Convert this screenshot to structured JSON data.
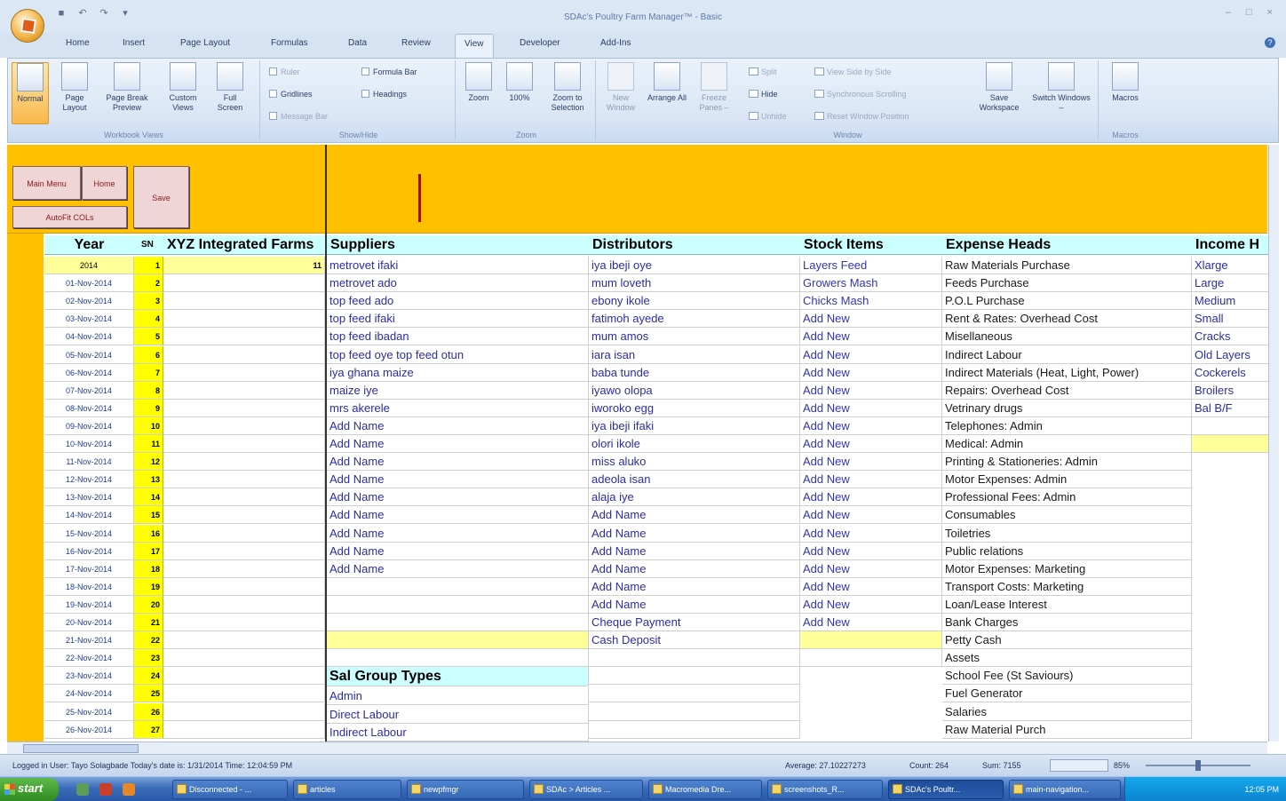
{
  "window": {
    "title": "SDAc's Poultry Farm Manager™ - Basic",
    "controls": "– □ ×"
  },
  "qat": {
    "save_icon": "■",
    "undo_icon": "↶",
    "redo_icon": "↷",
    "more_icon": "▾"
  },
  "ribbon_tabs": [
    "Home",
    "Insert",
    "Page Layout",
    "Formulas",
    "Data",
    "Review",
    "View",
    "Developer",
    "Add-Ins"
  ],
  "active_tab": "View",
  "ribbon": {
    "workbook_views": {
      "label": "Workbook Views",
      "buttons": [
        {
          "label": "Normal",
          "active": true
        },
        {
          "label": "Page Layout"
        },
        {
          "label": "Page Break Preview"
        },
        {
          "label": "Custom Views"
        },
        {
          "label": "Full Screen"
        }
      ]
    },
    "show_hide": {
      "label": "Show/Hide",
      "items": [
        "Ruler",
        "Formula Bar",
        "Gridlines",
        "Headings",
        "Message Bar"
      ]
    },
    "zoom": {
      "label": "Zoom",
      "buttons": [
        "Zoom",
        "100%",
        "Zoom to Selection"
      ]
    },
    "window": {
      "label": "Window",
      "buttons": [
        "New Window",
        "Arrange All",
        "Freeze Panes –"
      ],
      "small": [
        "Split",
        "Hide",
        "Unhide",
        "View Side by Side",
        "Synchronous Scrolling",
        "Reset Window Position"
      ],
      "big": [
        "Save Workspace",
        "Switch Windows –"
      ]
    },
    "macros": {
      "label": "Macros",
      "button": "Macros"
    }
  },
  "header_buttons": {
    "main_menu": "Main Menu",
    "home": "Home",
    "save": "Save",
    "autofit": "AutoFit COLs"
  },
  "columns": {
    "year": "Year",
    "sn": "SN",
    "farm": "XYZ Integrated Farms",
    "suppliers": "Suppliers",
    "distributors": "Distributors",
    "stock": "Stock Items",
    "expense": "Expense Heads",
    "income": "Income H"
  },
  "rows": {
    "dates": [
      "2014",
      "01-Nov-2014",
      "02-Nov-2014",
      "03-Nov-2014",
      "04-Nov-2014",
      "05-Nov-2014",
      "06-Nov-2014",
      "07-Nov-2014",
      "08-Nov-2014",
      "09-Nov-2014",
      "10-Nov-2014",
      "11-Nov-2014",
      "12-Nov-2014",
      "13-Nov-2014",
      "14-Nov-2014",
      "15-Nov-2014",
      "16-Nov-2014",
      "17-Nov-2014",
      "18-Nov-2014",
      "19-Nov-2014",
      "20-Nov-2014",
      "21-Nov-2014",
      "22-Nov-2014",
      "23-Nov-2014",
      "24-Nov-2014",
      "25-Nov-2014",
      "26-Nov-2014"
    ],
    "sn": [
      "1",
      "2",
      "3",
      "4",
      "5",
      "6",
      "7",
      "8",
      "9",
      "10",
      "11",
      "12",
      "13",
      "14",
      "15",
      "16",
      "17",
      "18",
      "19",
      "20",
      "21",
      "22",
      "23",
      "24",
      "25",
      "26",
      "27"
    ],
    "farm": [
      "11"
    ],
    "suppliers": [
      "metrovet ifaki",
      "metrovet ado",
      "top feed ado",
      "top feed ifaki",
      "top feed ibadan",
      "top feed oye top feed otun",
      "iya ghana maize",
      "maize iye",
      "mrs akerele",
      "Add Name",
      "Add Name",
      "Add Name",
      "Add Name",
      "Add Name",
      "Add Name",
      "Add Name",
      "Add Name",
      "Add Name"
    ],
    "distributors": [
      "iya ibeji oye",
      "mum loveth",
      "ebony ikole",
      "fatimoh ayede",
      "mum amos",
      "iara isan",
      "baba tunde",
      "iyawo olopa",
      "iworoko egg",
      "iya ibeji ifaki",
      "olori ikole",
      "miss aluko",
      "adeola isan",
      "alaja iye",
      "Add Name",
      "Add Name",
      "Add Name",
      "Add Name",
      "Add Name",
      "Add Name",
      "Cheque Payment",
      "Cash Deposit"
    ],
    "stock": [
      "Layers Feed",
      "Growers Mash",
      "Chicks Mash",
      "Add New",
      "Add New",
      "Add New",
      "Add New",
      "Add New",
      "Add New",
      "Add New",
      "Add New",
      "Add New",
      "Add New",
      "Add New",
      "Add New",
      "Add New",
      "Add New",
      "Add New",
      "Add New",
      "Add New",
      "Add New"
    ],
    "expense": [
      "Raw Materials Purchase",
      "Feeds Purchase",
      "P.O.L Purchase",
      "Rent & Rates: Overhead Cost",
      "Misellaneous",
      "Indirect Labour",
      "Indirect Materials (Heat, Light, Power)",
      "Repairs: Overhead Cost",
      "Vetrinary drugs",
      "Telephones: Admin",
      "Medical: Admin",
      "Printing & Stationeries: Admin",
      "Motor Expenses: Admin",
      "Professional Fees: Admin",
      "Consumables",
      "Toiletries",
      "Public relations",
      "Motor Expenses: Marketing",
      "Transport Costs: Marketing",
      "Loan/Lease Interest",
      "Bank Charges",
      "Petty Cash",
      "Assets",
      "School Fee (St Saviours)",
      "Fuel Generator",
      "Salaries",
      "Raw Material Purch"
    ],
    "income": [
      "Xlarge",
      "Large",
      "Medium",
      "Small",
      "Cracks",
      "Old Layers",
      "Cockerels",
      "Broilers",
      "Bal B/F"
    ]
  },
  "sal_group": {
    "title": "Sal Group Types",
    "items": [
      "Admin",
      "Direct Labour",
      "Indirect Labour"
    ]
  },
  "status": {
    "left": "Logged in User: Tayo Solagbade Today's date is: 1/31/2014 Time: 12:04:59 PM",
    "average": "Average: 27.10227273",
    "count": "Count: 264",
    "sum": "Sum: 7155",
    "zoom": "85%"
  },
  "taskbar": {
    "start": "start",
    "items": [
      "Disconnected - ...",
      "articles",
      "newpfmgr",
      "SDAc > Articles ...",
      "Macromedia Dre...",
      "screenshots_R...",
      "SDAc's Poultr...",
      "main-navigation..."
    ],
    "active": "SDAc's Poultr...",
    "clock": "12:05 PM"
  }
}
